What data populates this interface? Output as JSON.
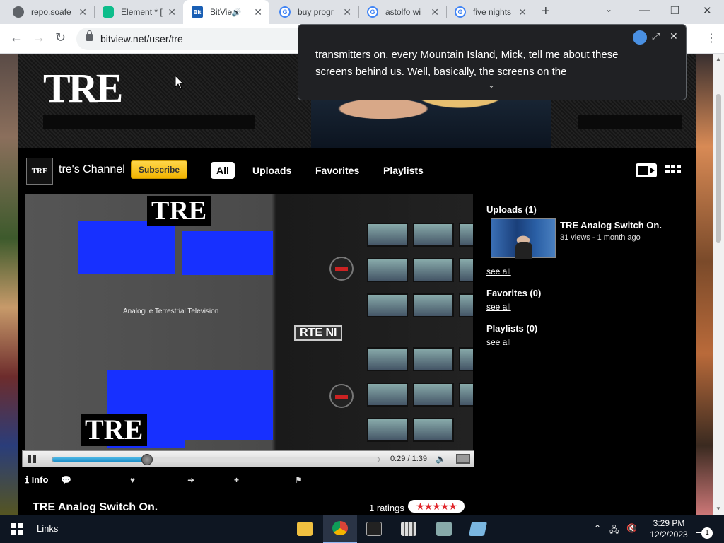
{
  "browser": {
    "tabs": [
      {
        "label": "repo.soafe",
        "favicon_color": "#5f6368",
        "icon": "ball-icon"
      },
      {
        "label": "Element * [",
        "favicon_color": "#0dbd8b",
        "icon": "element-icon"
      },
      {
        "label": "BitVie",
        "favicon_color": "#1a5fb4",
        "icon": "bitview-icon",
        "active": true
      },
      {
        "label": "buy progr",
        "favicon_color": "#4285f4",
        "icon": "google-icon"
      },
      {
        "label": "astolfo wi",
        "favicon_color": "#4285f4",
        "icon": "google-icon"
      },
      {
        "label": "five nights",
        "favicon_color": "#4285f4",
        "icon": "google-icon"
      }
    ],
    "url": "bitview.net/user/tre"
  },
  "caption": {
    "text": "transmitters on, every Mountain Island, Mick, tell me about these screens behind us. Well, basically, the screens on the"
  },
  "banner": {
    "logo": "TRE"
  },
  "channel": {
    "avatar_text": "TRE",
    "name": "tre's Channel",
    "subscribe_label": "Subscribe",
    "tabs": [
      "All",
      "Uploads",
      "Favorites",
      "Playlists"
    ]
  },
  "player": {
    "logo_top": "TRE",
    "logo_bottom": "TRE",
    "sign": "RTE NI",
    "wall_text": "Analogue Terrestrial Television",
    "time": "0:29 / 1:39",
    "progress": 0.29
  },
  "video_info": {
    "info_label": "Info",
    "title": "TRE Analog Switch On.",
    "ratings": "1 ratings",
    "stars": 5
  },
  "sidebar": {
    "uploads_heading": "Uploads (1)",
    "upload_title": "TRE Analog Switch On.",
    "upload_meta": "31 views - 1 month ago",
    "see_all": "see all",
    "favorites_heading": "Favorites (0)",
    "playlists_heading": "Playlists (0)"
  },
  "taskbar": {
    "links": "Links",
    "time": "3:29 PM",
    "date": "12/2/2023",
    "notifications": "1"
  }
}
